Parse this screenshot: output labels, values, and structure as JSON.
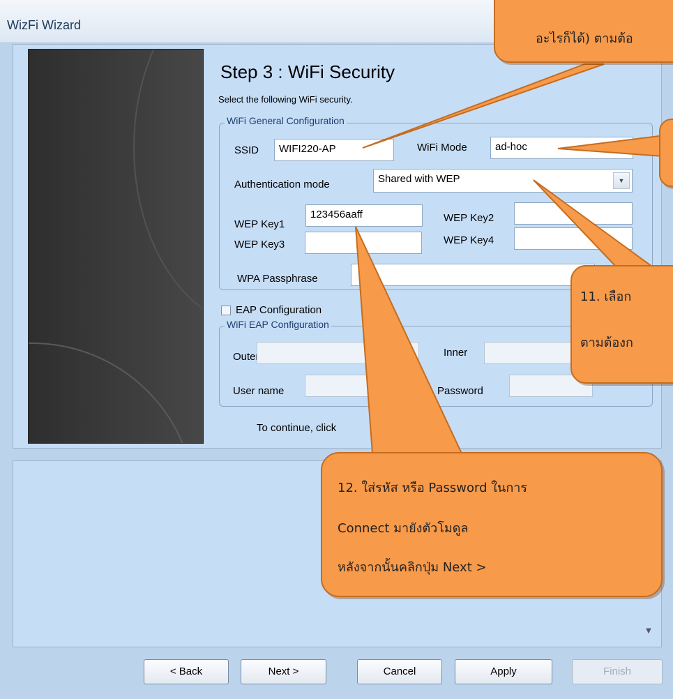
{
  "window": {
    "title": "WizFi Wizard"
  },
  "wizard": {
    "step_title": "Step 3 : WiFi Security",
    "step_subtitle": "Select the following WiFi security.",
    "general_group": {
      "title": "WiFi General Configuration",
      "ssid_label": "SSID",
      "ssid_value": "WIFI220-AP",
      "mode_label": "WiFi Mode",
      "mode_value": "ad-hoc",
      "auth_label": "Authentication mode",
      "auth_value": "Shared with WEP",
      "wep_key1_label": "WEP Key1",
      "wep_key1_value": "123456aaff",
      "wep_key2_label": "WEP Key2",
      "wep_key2_value": "",
      "wep_key3_label": "WEP Key3",
      "wep_key3_value": "",
      "wep_key4_label": "WEP Key4",
      "wep_key4_value": "",
      "wpa_label": "WPA Passphrase",
      "wpa_value": ""
    },
    "eap_checkbox_label": "EAP Configuration",
    "eap_checked": false,
    "eap_group": {
      "title": "WiFi EAP Configuration",
      "outer_label": "Outer",
      "inner_label": "Inner",
      "username_label": "User name",
      "password_label": "Password"
    },
    "continue_text": "To continue, click"
  },
  "buttons": {
    "back": "< Back",
    "next": "Next >",
    "cancel": "Cancel",
    "apply": "Apply",
    "finish": "Finish"
  },
  "callouts": {
    "top": "อะไรก็ได้) ตามต้อ",
    "right_line1": "11. เลือก",
    "right_line2": "ตามต้องก",
    "bottom_line1": "12. ใส่รหัส หรือ Password ในการ",
    "bottom_line2": "Connect มายังตัวโมดูล",
    "bottom_line3": "หลังจากนั้นคลิกปุ่ม Next >"
  },
  "colors": {
    "panel_bg": "#c6ddf6",
    "callout_fill": "#f79a4a",
    "callout_border": "#c46d20"
  }
}
